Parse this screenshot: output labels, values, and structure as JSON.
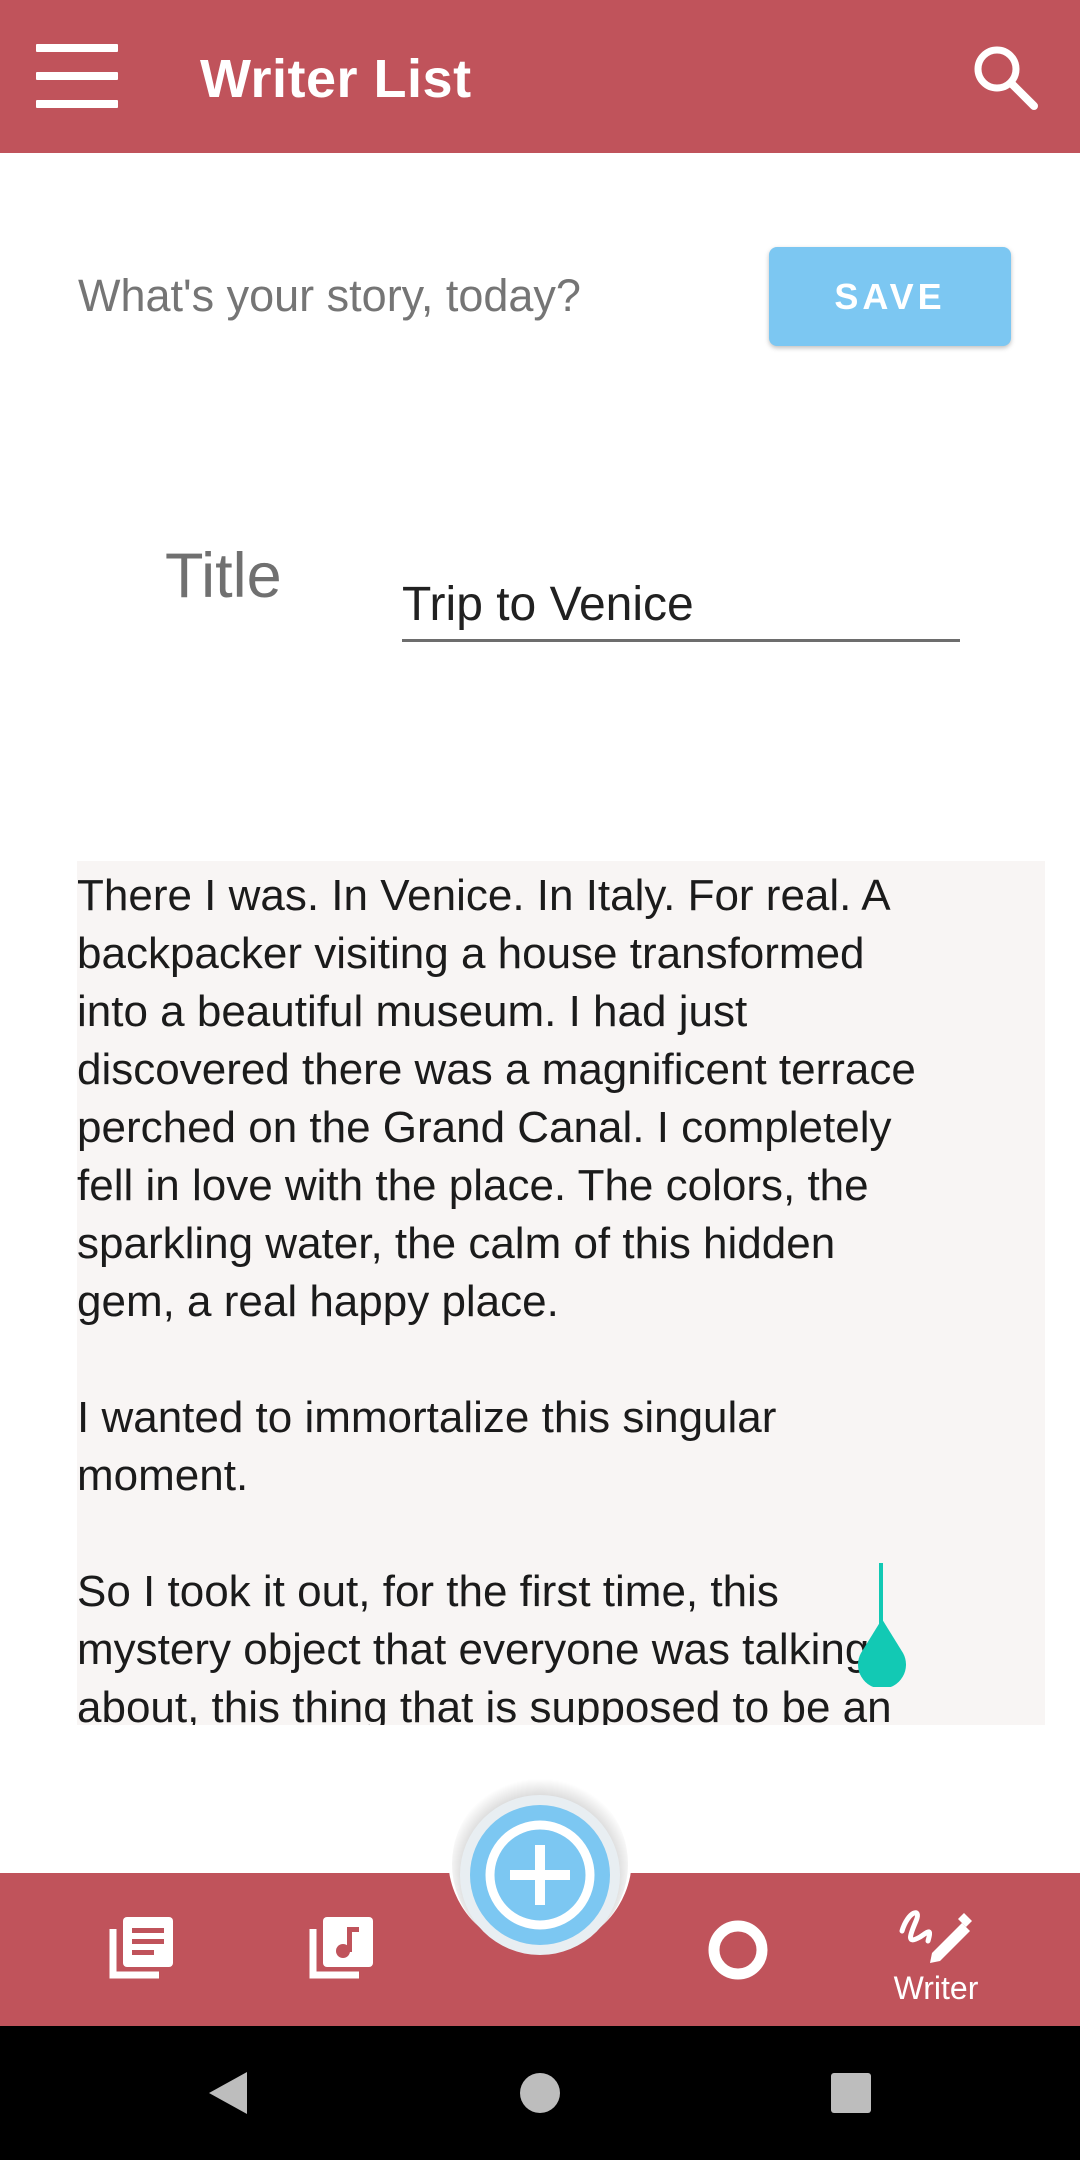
{
  "app_bar": {
    "title": "Writer List",
    "menu_icon": "hamburger-menu-icon",
    "search_icon": "search-icon",
    "color": "#C0535B"
  },
  "editor": {
    "prompt": "What's your story, today?",
    "save_label": "SAVE",
    "save_color": "#7CC7F2",
    "title_label": "Title",
    "title_value": "Trip to Venice",
    "story": "There I was. In Venice. In Italy. For real. A\nbackpacker visiting a house transformed\ninto a beautiful museum. I had just\ndiscovered there was a magnificent terrace\nperched on the Grand Canal. I completely\nfell in love with the place. The colors, the\nsparkling water, the calm of this hidden\ngem, a real happy place.\n\nI wanted to immortalize this singular\nmoment.\n\nSo I took it out, for the first time, this\nmystery object that everyone was talking\nabout, this thing that is supposed to be an",
    "cursor_color": "#12C9B4"
  },
  "bottom_nav": {
    "items": [
      {
        "icon": "library-books-icon",
        "label": ""
      },
      {
        "icon": "library-music-icon",
        "label": ""
      },
      {
        "icon": "add-circle-icon",
        "label": ""
      },
      {
        "icon": "ring-icon",
        "label": ""
      },
      {
        "icon": "draw-pen-icon",
        "label": "Writer"
      }
    ]
  },
  "system_nav": {
    "back_icon": "back-triangle-icon",
    "home_icon": "home-circle-icon",
    "recents_icon": "recents-square-icon"
  }
}
